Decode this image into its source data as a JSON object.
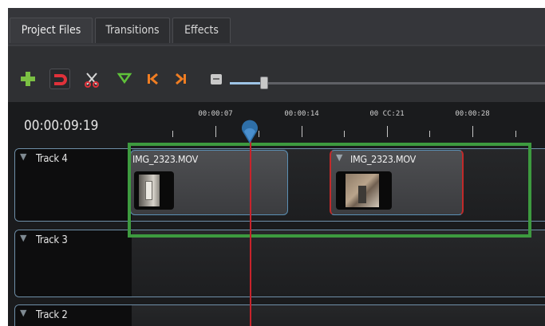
{
  "tabs": [
    {
      "label": "Project Files",
      "active": true
    },
    {
      "label": "Transitions",
      "active": false
    },
    {
      "label": "Effects",
      "active": false
    }
  ],
  "toolbar": {
    "icons": [
      "add-track-icon",
      "snap-icon",
      "razor-icon",
      "add-marker-icon",
      "previous-marker-icon",
      "next-marker-icon",
      "zoom-out-icon"
    ],
    "zoom_level": 0.11
  },
  "timeline": {
    "current_time": "00:00:09:19",
    "ruler_labels": [
      "00:00:07",
      "00:00:14",
      "00 CC:21",
      "00:00:28"
    ],
    "tracks": [
      {
        "name": "Track 4"
      },
      {
        "name": "Track 3"
      },
      {
        "name": "Track 2"
      }
    ],
    "clips": [
      {
        "title": "IMG_2323.MOV",
        "track": "Track 4",
        "selected": false
      },
      {
        "title": "IMG_2323.MOV",
        "track": "Track 4",
        "selected": true
      }
    ]
  },
  "colors": {
    "highlight": "#3d9a3f",
    "playhead": "#c8232b",
    "track_border": "#6f8fa8",
    "selected_clip_border": "#c12a2a"
  }
}
